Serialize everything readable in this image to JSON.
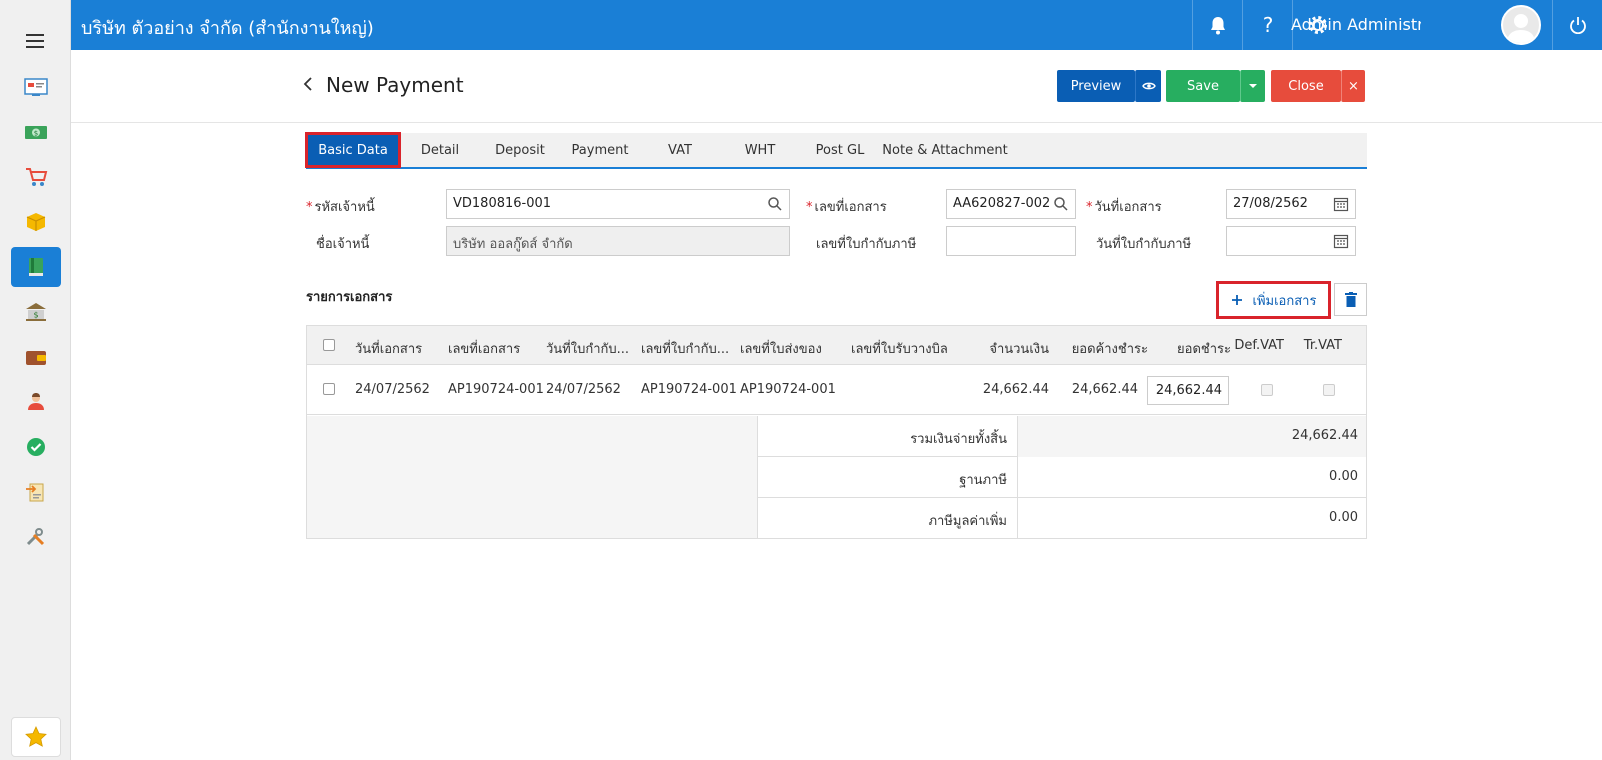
{
  "header": {
    "company": "บริษัท ตัวอย่าง จำกัด (สำนักงานใหญ่)",
    "user": "Admin Administr..."
  },
  "page": {
    "title": "New Payment",
    "buttons": {
      "preview": "Preview",
      "save": "Save",
      "close": "Close",
      "close_x": "×"
    }
  },
  "tabs": [
    "Basic Data",
    "Detail",
    "Deposit",
    "Payment",
    "VAT",
    "WHT",
    "Post GL",
    "Note & Attachment"
  ],
  "form": {
    "creditor_code_label": "รหัสเจ้าหนี้",
    "creditor_code": "VD180816-001",
    "creditor_name_label": "ชื่อเจ้าหนี้",
    "creditor_name": "บริษัท ออลกู๊ดส์ จำกัด",
    "doc_no_label": "เลขที่เอกสาร",
    "doc_no": "AA620827-002",
    "tax_inv_no_label": "เลขที่ใบกำกับภาษี",
    "tax_inv_no": "",
    "doc_date_label": "วันที่เอกสาร",
    "doc_date": "27/08/2562",
    "tax_inv_date_label": "วันที่ใบกำกับภาษี",
    "tax_inv_date": ""
  },
  "documents": {
    "section_title": "รายการเอกสาร",
    "add_button": "เพิ่มเอกสาร",
    "columns": [
      "วันที่เอกสาร",
      "เลขที่เอกสาร",
      "วันที่ใบกำกับ...",
      "เลขที่ใบกำกับ...",
      "เลขที่ใบส่งของ",
      "เลขที่ใบรับวางบิล",
      "จำนวนเงิน",
      "ยอดค้างชำระ",
      "ยอดชำระ",
      "Def.VAT",
      "Tr.VAT"
    ],
    "row": {
      "doc_date": "24/07/2562",
      "doc_no": "AP190724-001",
      "tax_inv_date": "24/07/2562",
      "tax_inv_no": "AP190724-001",
      "delivery_no": "AP190724-001",
      "billing_no": "",
      "amount": "24,662.44",
      "outstanding": "24,662.44",
      "payment": "24,662.44"
    },
    "summary": {
      "total_label": "รวมเงินจ่ายทั้งสิ้น",
      "total": "24,662.44",
      "base_label": "ฐานภาษี",
      "base": "0.00",
      "vat_label": "ภาษีมูลค่าเพิ่ม",
      "vat": "0.00"
    }
  }
}
